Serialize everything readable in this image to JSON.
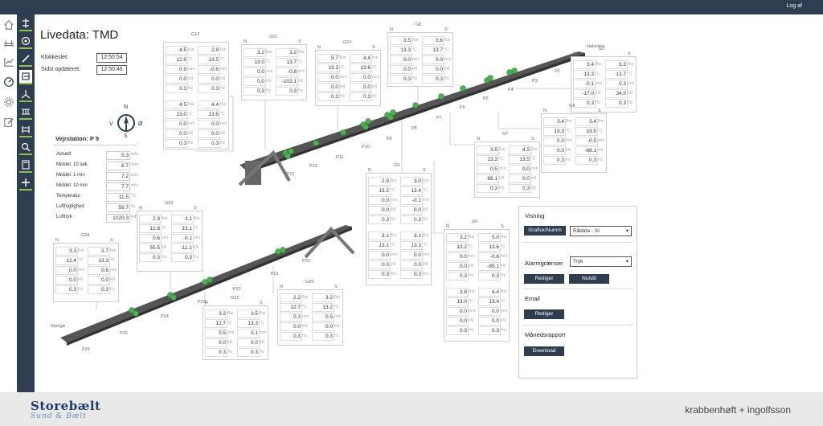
{
  "header": {
    "logout": "Log af"
  },
  "page": {
    "title": "Livedata: TMD"
  },
  "clock": {
    "label_now": "Klokkeslet:",
    "now": "12:50:54",
    "label_updated": "Sidst opdateret:",
    "updated": "12:50:46"
  },
  "compass": {
    "n": "N",
    "s": "S",
    "v": "V",
    "o": "Ø"
  },
  "weather": {
    "title": "Vejrstation: P 9",
    "rows": [
      {
        "name": "Aktuelt",
        "value": "5.3",
        "unit": "m/s"
      },
      {
        "name": "Middel: 10 sek",
        "value": "6.7",
        "unit": "m/s"
      },
      {
        "name": "Middel: 1 min",
        "value": "7.2",
        "unit": "m/s"
      },
      {
        "name": "Middel: 10 min",
        "value": "7.7",
        "unit": "m/s"
      },
      {
        "name": "Temperatur",
        "value": "11.5",
        "unit": "°C"
      },
      {
        "name": "Luftfugtighed",
        "value": "59.7",
        "unit": "%"
      },
      {
        "name": "Lufttryk",
        "value": "1020.3",
        "unit": "mBar"
      }
    ]
  },
  "units": [
    "Bar",
    "°C",
    "mm",
    "kN",
    "Hz"
  ],
  "groups": [
    {
      "id": "G12",
      "n": "",
      "s": "",
      "top": [
        [
          "4.5",
          "2.8"
        ],
        [
          "12.9",
          "13.5"
        ],
        [
          "0.9",
          "-0.6"
        ],
        [
          "0.0",
          "0.0"
        ],
        [
          "0.3",
          "0.3"
        ]
      ],
      "bottom": [
        [
          "4.5",
          "4.4"
        ],
        [
          "13.0",
          "13.6"
        ],
        [
          "0.0",
          "0.0"
        ],
        [
          "0.0",
          "0.0"
        ],
        [
          "0.3",
          "0.3"
        ]
      ]
    },
    {
      "id": "G11",
      "n": "N",
      "s": "S",
      "top": [
        [
          "3.2",
          "3.2"
        ],
        [
          "13.0",
          "13.7"
        ],
        [
          "0.0",
          "-0.8"
        ],
        [
          "0.0",
          "-102.1"
        ],
        [
          "0.3",
          "0.3"
        ]
      ]
    },
    {
      "id": "G10",
      "n": "N",
      "s": "S",
      "top": [
        [
          "5.7",
          "4.4"
        ],
        [
          "13.3",
          "13.6"
        ],
        [
          "0.0",
          "0.0"
        ],
        [
          "0.0",
          "0.0"
        ],
        [
          "0.3",
          "0.3"
        ]
      ]
    },
    {
      "id": "G8",
      "n": "N",
      "s": "S",
      "top": [
        [
          "3.5",
          "3.6"
        ],
        [
          "13.3",
          "13.7"
        ],
        [
          "0.0",
          "0.0"
        ],
        [
          "0.0",
          "0.0"
        ],
        [
          "0.3",
          "0.3"
        ]
      ]
    },
    {
      "id": "G3",
      "n": "N",
      "s": "S",
      "top": [
        [
          "3.4",
          "3.3"
        ],
        [
          "13.3",
          "13.7"
        ],
        [
          "-0.1",
          "0.3"
        ],
        [
          "-17.0",
          "34.0"
        ],
        [
          "0.3",
          "0.3"
        ]
      ]
    },
    {
      "id": "G4",
      "n": "N",
      "s": "S",
      "top": [
        [
          "3.4",
          "3.4"
        ],
        [
          "13.3",
          "13.9"
        ],
        [
          "0.0",
          "-0.5"
        ],
        [
          "0.0",
          "-68.1"
        ],
        [
          "0.3",
          "0.3"
        ]
      ]
    },
    {
      "id": "G7",
      "n": "N",
      "s": "S",
      "top": [
        [
          "3.5",
          "4.5"
        ],
        [
          "13.3",
          "13.5"
        ],
        [
          "0.5",
          "0.0"
        ],
        [
          "68.1",
          "0.0"
        ],
        [
          "0.3",
          "0.3"
        ]
      ]
    },
    {
      "id": "G9",
      "n": "N",
      "s": "S",
      "top": [
        [
          "2.9",
          "3.0"
        ],
        [
          "13.2",
          "13.4"
        ],
        [
          "0.0",
          "-0.1"
        ],
        [
          "0.0",
          "0.0"
        ],
        [
          "0.3",
          "0.3"
        ]
      ],
      "bottom": [
        [
          "3.1",
          "3.1"
        ],
        [
          "13.1",
          "13.3"
        ],
        [
          "0.0",
          "0.0"
        ],
        [
          "0.0",
          "0.0"
        ],
        [
          "0.3",
          "0.3"
        ]
      ]
    },
    {
      "id": "G6",
      "n": "N",
      "s": "S",
      "top": [
        [
          "3.2",
          "5.0"
        ],
        [
          "13.2",
          "13.6"
        ],
        [
          "0.0",
          "-0.6"
        ],
        [
          "0.0",
          "-85.1"
        ],
        [
          "0.3",
          "0.3"
        ]
      ],
      "bottom": [
        [
          "3.8",
          "4.4"
        ],
        [
          "13.0",
          "13.4"
        ],
        [
          "0.0",
          "0.0"
        ],
        [
          "0.0",
          "0.0"
        ],
        [
          "0.3",
          "0.3"
        ]
      ]
    },
    {
      "id": "G23",
      "n": "N",
      "s": "S",
      "top": [
        [
          "2.9",
          "3.1"
        ],
        [
          "12.8",
          "13.1"
        ],
        [
          "0.6",
          "-0.1"
        ],
        [
          "55.5",
          "-11.1"
        ],
        [
          "0.3",
          "0.3"
        ]
      ]
    },
    {
      "id": "G24",
      "n": "N",
      "s": "S",
      "top": [
        [
          "3.3",
          "2.7"
        ],
        [
          "12.4",
          "13.3"
        ],
        [
          "0.0",
          "0.6"
        ],
        [
          "0.0",
          "0.0"
        ],
        [
          "0.3",
          "0.3"
        ]
      ]
    },
    {
      "id": "G22",
      "n": "N",
      "s": "S",
      "top": [
        [
          "3.2",
          "3.5"
        ],
        [
          "12.7",
          "13.3"
        ],
        [
          "0.5",
          "0.1"
        ],
        [
          "0.0",
          "0.0"
        ],
        [
          "0.3",
          "0.3"
        ]
      ]
    },
    {
      "id": "G20",
      "n": "N",
      "s": "S",
      "top": [
        [
          "2.2",
          "3.2"
        ],
        [
          "12.7",
          "13.2"
        ],
        [
          "0.3",
          "0.5"
        ],
        [
          "0.0",
          "0.0"
        ],
        [
          "0.3",
          "0.3"
        ]
      ]
    }
  ],
  "bridge_labels": [
    "P13",
    "P12",
    "P11",
    "P10",
    "P9",
    "P8",
    "P7",
    "P6",
    "P5",
    "P4",
    "P3",
    "P2",
    "Halsskov",
    "P21",
    "P22",
    "P23",
    "P24",
    "P25",
    "P26",
    "Sprogø",
    "P20"
  ],
  "controls": {
    "visning": "Visning",
    "graf_btn": "Grafisk/Numm",
    "view_select": "Rådata - SI",
    "alarm": "Alarmgrænser",
    "alarm_select": "Tryk",
    "edit1": "Rediger",
    "reset": "Nulstil",
    "email": "Email",
    "edit2": "Rediger",
    "report": "Månedsrapport",
    "download": "Download"
  },
  "footer": {
    "logo_main": "Storebælt",
    "logo_sub": "Sund & Bælt",
    "partner": "krabbenhøft + ingolfsson"
  }
}
